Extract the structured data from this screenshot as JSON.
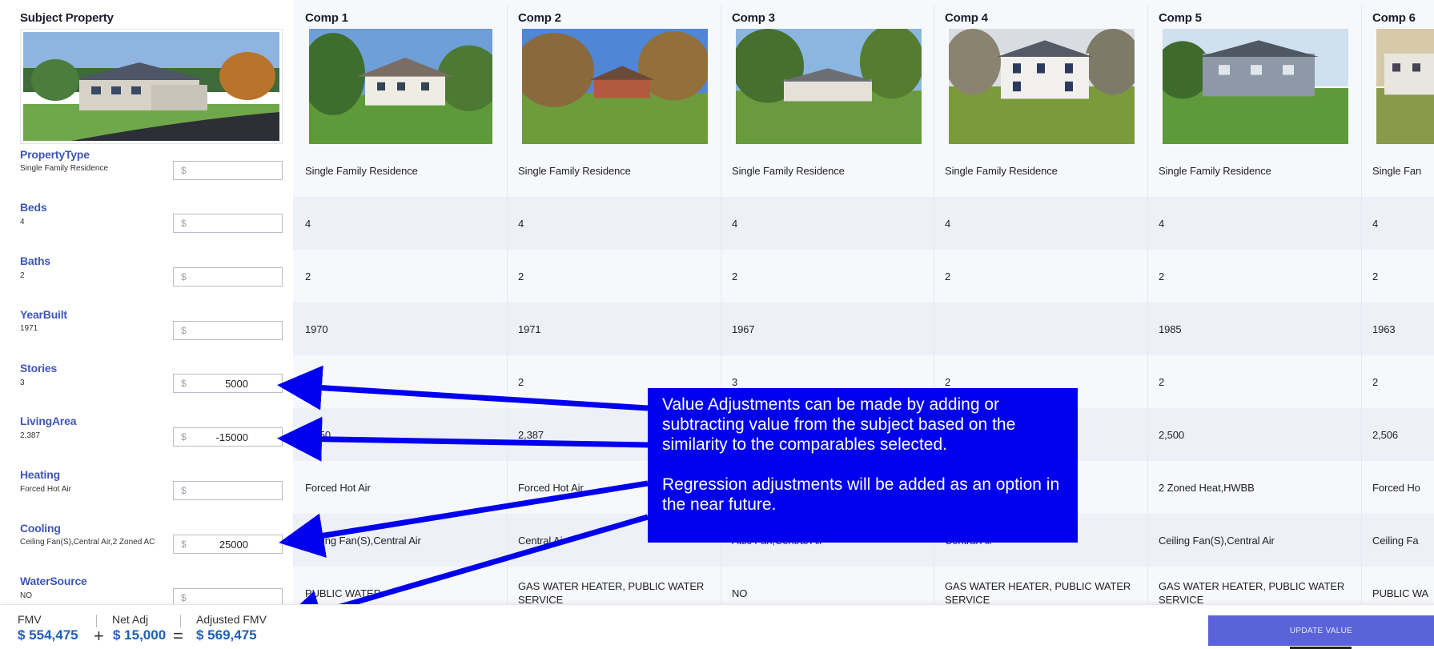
{
  "subject": {
    "title": "Subject Property",
    "attributes": [
      {
        "label": "PropertyType",
        "value": "Single Family Residence",
        "currency": "$",
        "adjustment": ""
      },
      {
        "label": "Beds",
        "value": "4",
        "currency": "$",
        "adjustment": ""
      },
      {
        "label": "Baths",
        "value": "2",
        "currency": "$",
        "adjustment": ""
      },
      {
        "label": "YearBuilt",
        "value": "1971",
        "currency": "$",
        "adjustment": ""
      },
      {
        "label": "Stories",
        "value": "3",
        "currency": "$",
        "adjustment": "5000"
      },
      {
        "label": "LivingArea",
        "value": "2,387",
        "currency": "$",
        "adjustment": "-15000"
      },
      {
        "label": "Heating",
        "value": "Forced Hot Air",
        "currency": "$",
        "adjustment": ""
      },
      {
        "label": "Cooling",
        "value": "Ceiling Fan(S),Central Air,2 Zoned AC",
        "currency": "$",
        "adjustment": "25000"
      },
      {
        "label": "WaterSource",
        "value": "NO",
        "currency": "$",
        "adjustment": ""
      }
    ]
  },
  "comps": [
    {
      "title": "Comp 1",
      "values": [
        "Single Family Residence",
        "4",
        "2",
        "1970",
        "",
        "2,450",
        "Forced Hot Air",
        "Ceiling Fan(S),Central Air",
        "PUBLIC WATER"
      ]
    },
    {
      "title": "Comp 2",
      "values": [
        "Single Family Residence",
        "4",
        "2",
        "1971",
        "2",
        "2,387",
        "Forced Hot Air",
        "Central Air",
        "GAS WATER HEATER, PUBLIC WATER SERVICE"
      ]
    },
    {
      "title": "Comp 3",
      "values": [
        "Single Family Residence",
        "4",
        "2",
        "1967",
        "3",
        "",
        "",
        "Attic Fan,Central Air",
        "NO"
      ]
    },
    {
      "title": "Comp 4",
      "values": [
        "Single Family Residence",
        "4",
        "2",
        "",
        "2",
        "",
        "",
        "Central Air",
        "GAS WATER HEATER, PUBLIC WATER SERVICE"
      ]
    },
    {
      "title": "Comp 5",
      "values": [
        "Single Family Residence",
        "4",
        "2",
        "1985",
        "2",
        "2,500",
        "2 Zoned Heat,HWBB",
        "Ceiling Fan(S),Central Air",
        "GAS WATER HEATER, PUBLIC WATER SERVICE"
      ]
    },
    {
      "title": "Comp 6",
      "values": [
        "Single Fan",
        "4",
        "2",
        "1963",
        "2",
        "2,506",
        "Forced Ho",
        "Ceiling Fa",
        "PUBLIC WA"
      ]
    }
  ],
  "callout": {
    "paragraph1": "Value Adjustments can be made by adding or subtracting value from the subject based on the similarity to the comparables selected.",
    "paragraph2": "Regression adjustments will be added as an option in the near future."
  },
  "footer": {
    "fmv_label": "FMV",
    "fmv_value": "$ 554,475",
    "plus": "+",
    "netadj_label": "Net Adj",
    "netadj_value": "$ 15,000",
    "equals": "=",
    "adjusted_label": "Adjusted FMV",
    "adjusted_value": "$ 569,475",
    "update_button": "UPDATE VALUE"
  },
  "colors": {
    "accent": "#3f56b8",
    "callout": "#0000ee",
    "arrow": "#0000ee",
    "button": "#5b63d9",
    "value_blue": "#1f5fb8"
  }
}
